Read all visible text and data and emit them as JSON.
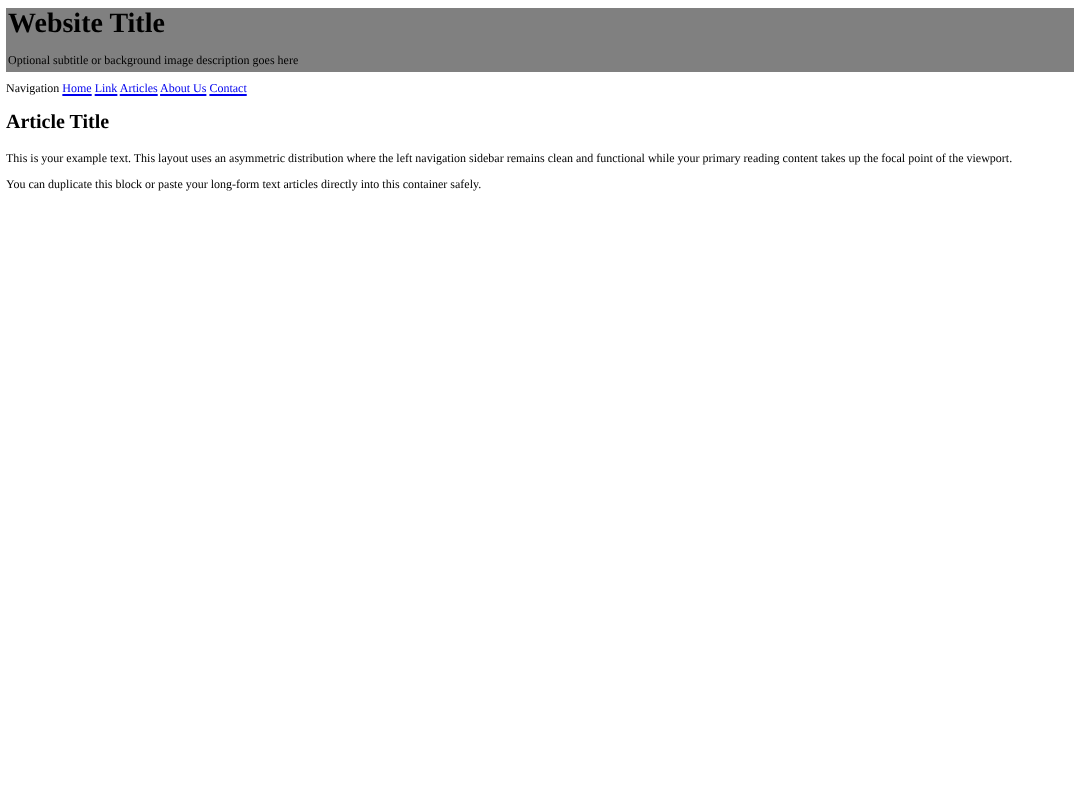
{
  "header": {
    "title": "Website Title",
    "subtitle": "Optional subtitle or background image description goes here"
  },
  "navigation": {
    "label": "Navigation",
    "links": [
      "Home",
      "Link",
      "Articles",
      "About Us",
      "Contact"
    ]
  },
  "article": {
    "title": "Article Title",
    "paragraphs": [
      "This is your example text. This layout uses an asymmetric distribution where the left navigation sidebar remains clean and functional while your primary reading content takes up the focal point of the viewport.",
      "You can duplicate this block or paste your long-form text articles directly into this container safely."
    ]
  }
}
